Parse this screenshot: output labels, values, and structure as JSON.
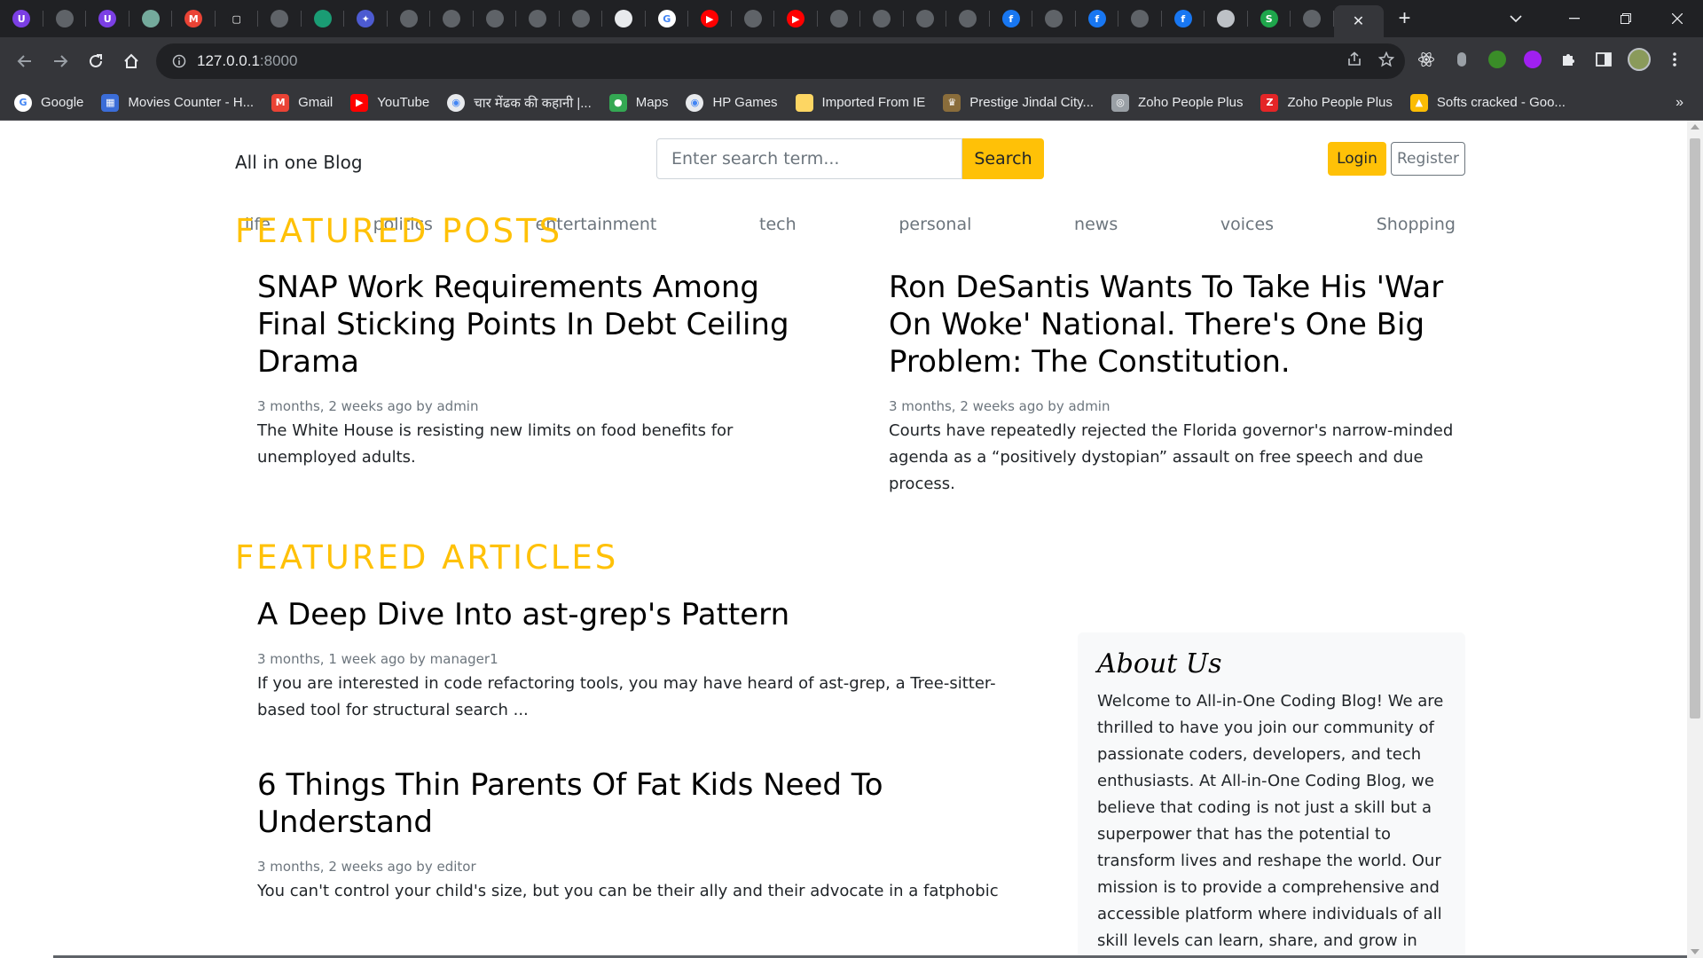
{
  "browser": {
    "tabs_mini": [
      {
        "icon": "u-extension-icon",
        "glyph": "U",
        "color": "#7b3fe4"
      },
      {
        "icon": "github-icon",
        "glyph": "",
        "color": "#5f6368"
      },
      {
        "icon": "u-extension-icon",
        "glyph": "U",
        "color": "#7b3fe4"
      },
      {
        "icon": "chatgpt-icon",
        "glyph": "",
        "color": "#74aa9c"
      },
      {
        "icon": "gmail-icon",
        "glyph": "M",
        "color": "#ea4335"
      },
      {
        "icon": "square-icon",
        "glyph": "▢",
        "color": "#202124"
      },
      {
        "icon": "github-icon",
        "glyph": "",
        "color": "#5f6368"
      },
      {
        "icon": "green-app-icon",
        "glyph": "",
        "color": "#1a9c74"
      },
      {
        "icon": "sparkle-icon",
        "glyph": "✦",
        "color": "#4d5bd1"
      },
      {
        "icon": "github-icon",
        "glyph": "",
        "color": "#5f6368"
      },
      {
        "icon": "github-icon",
        "glyph": "",
        "color": "#5f6368"
      },
      {
        "icon": "github-icon",
        "glyph": "",
        "color": "#5f6368"
      },
      {
        "icon": "globe-icon",
        "glyph": "",
        "color": "#5f6368"
      },
      {
        "icon": "globe-icon",
        "glyph": "",
        "color": "#5f6368"
      },
      {
        "icon": "chrome-icon",
        "glyph": "",
        "color": "#e8eaed"
      },
      {
        "icon": "google-icon",
        "glyph": "G",
        "color": "#ffffff"
      },
      {
        "icon": "youtube-icon",
        "glyph": "▶",
        "color": "#ff0000"
      },
      {
        "icon": "github-icon",
        "glyph": "",
        "color": "#5f6368"
      },
      {
        "icon": "youtube-icon",
        "glyph": "▶",
        "color": "#ff0000"
      },
      {
        "icon": "github-icon",
        "glyph": "",
        "color": "#5f6368"
      },
      {
        "icon": "globe-icon",
        "glyph": "",
        "color": "#5f6368"
      },
      {
        "icon": "globe-icon",
        "glyph": "",
        "color": "#5f6368"
      },
      {
        "icon": "globe-icon",
        "glyph": "",
        "color": "#5f6368"
      },
      {
        "icon": "facebook-icon",
        "glyph": "f",
        "color": "#1877f2"
      },
      {
        "icon": "globe-icon",
        "glyph": "",
        "color": "#5f6368"
      },
      {
        "icon": "facebook-icon",
        "glyph": "f",
        "color": "#1877f2"
      },
      {
        "icon": "globe-icon",
        "glyph": "",
        "color": "#5f6368"
      },
      {
        "icon": "facebook-icon",
        "glyph": "f",
        "color": "#1877f2"
      },
      {
        "icon": "database-icon",
        "glyph": "",
        "color": "#bdc1c6"
      },
      {
        "icon": "stripe-icon",
        "glyph": "S",
        "color": "#1ea64b"
      },
      {
        "icon": "globe-icon",
        "glyph": "",
        "color": "#5f6368"
      }
    ],
    "active_tab_close": "✕",
    "new_tab": "+",
    "url_host": "127.0.0.1",
    "url_port": ":8000",
    "bookmarks": [
      {
        "label": "Google",
        "icon": "google-icon",
        "color": "#ffffff",
        "glyph": "G"
      },
      {
        "label": "Movies Counter - H...",
        "icon": "movies-icon",
        "color": "#3b6dd8",
        "glyph": "▦"
      },
      {
        "label": "Gmail",
        "icon": "gmail-icon",
        "color": "#ea4335",
        "glyph": "M"
      },
      {
        "label": "YouTube",
        "icon": "youtube-icon",
        "color": "#ff0000",
        "glyph": "▶"
      },
      {
        "label": "चार मेंढक की कहानी |...",
        "icon": "globe-icon",
        "color": "#e8eaed",
        "glyph": "◉"
      },
      {
        "label": "Maps",
        "icon": "maps-icon",
        "color": "#34a853",
        "glyph": "●"
      },
      {
        "label": "HP Games",
        "icon": "globe-icon",
        "color": "#e8eaed",
        "glyph": "◉"
      },
      {
        "label": "Imported From IE",
        "icon": "folder-icon",
        "color": "#fdd663",
        "glyph": ""
      },
      {
        "label": "Prestige Jindal City...",
        "icon": "prestige-icon",
        "color": "#8a6d3b",
        "glyph": "♛"
      },
      {
        "label": "Zoho People Plus",
        "icon": "zoho-icon",
        "color": "#9aa0a6",
        "glyph": "◎"
      },
      {
        "label": "Zoho People Plus",
        "icon": "zoho-z-icon",
        "color": "#e42527",
        "glyph": "Z"
      },
      {
        "label": "Softs cracked - Goo...",
        "icon": "drive-icon",
        "color": "#fbbc04",
        "glyph": "▲"
      }
    ]
  },
  "site": {
    "brand": "All in one Blog",
    "search_placeholder": "Enter search term...",
    "search_label": "Search",
    "login_label": "Login",
    "register_label": "Register",
    "categories": [
      "life",
      "politics",
      "entertainment",
      "tech",
      "personal",
      "news",
      "voices",
      "Shopping"
    ],
    "featured_posts_heading": "FEATURED POSTS",
    "featured_posts": [
      {
        "title": "SNAP Work Requirements Among Final Sticking Points In Debt Ceiling Drama",
        "meta": "3 months, 2 weeks ago by admin",
        "excerpt": "The White House is resisting new limits on food benefits for unemployed adults."
      },
      {
        "title": "Ron DeSantis Wants To Take His 'War On Woke' National. There's One Big Problem: The Constitution.",
        "meta": "3 months, 2 weeks ago by admin",
        "excerpt": "Courts have repeatedly rejected the Florida governor's narrow-minded agenda as a “positively dystopian” assault on free speech and due process."
      }
    ],
    "featured_articles_heading": "FEATURED ARTICLES",
    "featured_articles": [
      {
        "title": "A Deep Dive Into ast-grep's Pattern",
        "meta": "3 months, 1 week ago by manager1",
        "excerpt": "If you are interested in code refactoring tools, you may have heard of ast-grep, a Tree-sitter-based tool for structural search ..."
      },
      {
        "title": "6 Things Thin Parents Of Fat Kids Need To Understand",
        "meta": "3 months, 2 weeks ago by editor",
        "excerpt": "You can't control your child's size, but you can be their ally and their advocate in a fatphobic"
      }
    ],
    "about": {
      "heading": "About Us",
      "text": "Welcome to All-in-One Coding Blog! We are thrilled to have you join our community of passionate coders, developers, and tech enthusiasts. At All-in-One Coding Blog, we believe that coding is not just a skill but a superpower that has the potential to transform lives and reshape the world. Our mission is to provide a comprehensive and accessible platform where individuals of all skill levels can learn, share, and grow in their"
    },
    "accent_color": "#ffc107"
  }
}
